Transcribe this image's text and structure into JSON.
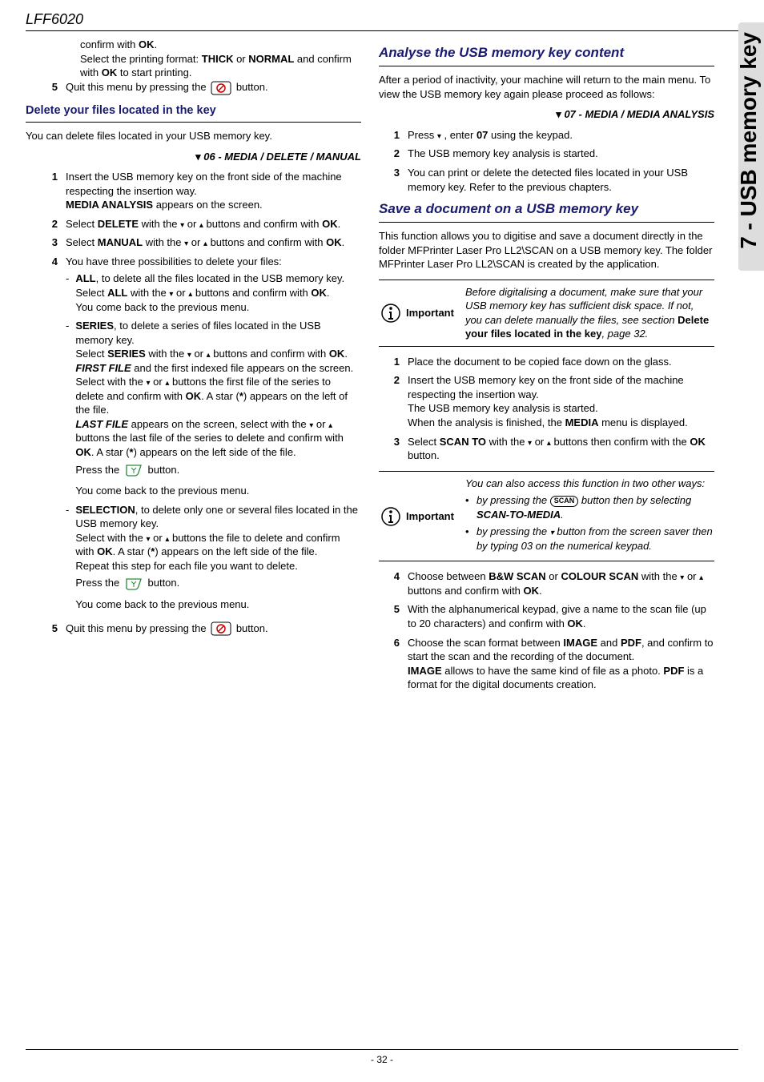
{
  "header": {
    "model": "LFF6020"
  },
  "side_tab": "7 - USB memory key",
  "footer": {
    "page_no": "- 32 -"
  },
  "left": {
    "intro": {
      "l1a": "confirm with ",
      "l1b": "OK",
      "l1c": ".",
      "l2a": "Select the printing format: ",
      "l2b": "THICK",
      "l2c": " or ",
      "l2d": "NORMAL",
      "l2e": " and confirm with ",
      "l2f": "OK",
      "l2g": " to start printing."
    },
    "step5": {
      "num": "5",
      "a": "Quit this menu by pressing the ",
      "b": " button."
    },
    "h3_delete": "Delete your files located in the key",
    "p_deleteintro": "You can delete files located in your USB memory key.",
    "menu06": "06 - MEDIA / DELETE / MANUAL",
    "d1": {
      "num": "1",
      "a": "Insert the USB memory key on the front side of the machine respecting the insertion way.",
      "b1": "MEDIA ANALYSIS",
      "b2": " appears on the screen."
    },
    "d2": {
      "num": "2",
      "a": "Select ",
      "b": "DELETE",
      "c": " with the ",
      "d": " or ",
      "e": " buttons and confirm with ",
      "f": "OK",
      "g": "."
    },
    "d3": {
      "num": "3",
      "a": "Select ",
      "b": "MANUAL",
      "c": " with the ",
      "d": " or ",
      "e": " buttons and confirm with ",
      "f": "OK",
      "g": "."
    },
    "d4": {
      "num": "4",
      "intro": "You have three possibilities to delete your files:",
      "all": {
        "a": "ALL",
        "b": ", to delete all the files located in the USB memory key.",
        "c": "Select ",
        "d": "ALL",
        "e": " with the ",
        "f": " or ",
        "g": " buttons and confirm with ",
        "h": "OK",
        "i": ".",
        "j": "You come back to the previous menu."
      },
      "series": {
        "a": "SERIES",
        "b": ", to delete a series of files located in the USB memory key.",
        "c": "Select ",
        "d": "SERIES",
        "e": " with the ",
        "f": " or ",
        "g": " buttons and confirm with ",
        "h": "OK",
        "i": ".",
        "j1": "FIRST FILE",
        "j2": " and the first indexed file appears on the screen. Select with the ",
        "j3": " or ",
        "j4": " buttons the first file of the series to delete and confirm with ",
        "j5": "OK",
        "j6": ". A star (",
        "j7": "*",
        "j8": ") appears on the left of the file.",
        "k1": "LAST FILE",
        "k2": " appears on the screen, select with the ",
        "k3": " or ",
        "k4": " buttons the last file of the series to delete and confirm with ",
        "k5": "OK",
        "k6": ". A star (",
        "k7": "*",
        "k8": ") appears on the left side of the file.",
        "l1": "Press the ",
        "l2": " button.",
        "m": "You come back to the previous menu."
      },
      "selection": {
        "a": "SELECTION",
        "b": ", to delete only one or several files located in the USB memory key.",
        "c": "Select with the ",
        "d": " or ",
        "e": " buttons the file to delete and confirm with ",
        "f": "OK",
        "g": ". A star (",
        "h": "*",
        "i": ") appears on the left side of the file.",
        "j": "Repeat this step for each file you want to delete.",
        "k1": "Press the ",
        "k2": " button.",
        "l": "You come back to the previous menu."
      }
    },
    "d5": {
      "num": "5",
      "a": "Quit this menu by pressing the ",
      "b": " button."
    }
  },
  "right": {
    "h2_analyse": "Analyse the USB memory key content",
    "p_analyse": "After a period of inactivity, your machine will return to the main menu. To view the USB memory key again please proceed as follows:",
    "menu07": "07 - MEDIA / MEDIA ANALYSIS",
    "a1": {
      "num": "1",
      "a": "Press ",
      "b": " , enter ",
      "c": "07",
      "d": " using the keypad."
    },
    "a2": {
      "num": "2",
      "a": "The USB memory key analysis is started."
    },
    "a3": {
      "num": "3",
      "a": "You can print or delete the detected files located in your USB memory key. Refer to the previous chapters."
    },
    "h2_save": "Save a document on a USB memory key",
    "p_save": "This function allows you to digitise and save a document directly in the folder MFPrinter Laser Pro LL2\\SCAN on a USB memory key. The folder MFPrinter Laser Pro LL2\\SCAN is created by the application.",
    "imp1": {
      "label": "Important",
      "a": "Before digitalising a document, make sure that your USB memory key has sufficient disk space. If not, you can delete manually the files, see section ",
      "b": "Delete your files located in the key",
      "c": ", page 32."
    },
    "s1": {
      "num": "1",
      "a": "Place the document to be copied face down on the glass."
    },
    "s2": {
      "num": "2",
      "a": "Insert the USB memory key on the front side of the machine respecting the insertion way.",
      "b": "The USB memory key analysis is started.",
      "c1": "When the analysis is finished, the ",
      "c2": "MEDIA",
      "c3": " menu is displayed."
    },
    "s3": {
      "num": "3",
      "a": "Select ",
      "b": "SCAN TO",
      "c": " with the ",
      "d": " or ",
      "e": " buttons then confirm with the ",
      "f": "OK",
      "g": " button."
    },
    "imp2": {
      "label": "Important",
      "intro": "You can also access this function in two other ways:",
      "b1a": "by pressing the ",
      "b1key": "SCAN",
      "b1b": " button then by selecting ",
      "b1c": "SCAN-TO-MEDIA",
      "b1d": ".",
      "b2a": "by pressing the ",
      "b2b": " button from the screen saver then by typing 03 on the numerical keypad."
    },
    "s4": {
      "num": "4",
      "a": "Choose between ",
      "b": "B&W SCAN",
      "c": " or ",
      "d": "COLOUR SCAN",
      "e": " with the ",
      "f": " or ",
      "g": " buttons and confirm with ",
      "h": "OK",
      "i": "."
    },
    "s5": {
      "num": "5",
      "a": "With the alphanumerical keypad, give a name to the scan file (up to 20 characters) and confirm with ",
      "b": "OK",
      "c": "."
    },
    "s6": {
      "num": "6",
      "a": "Choose the scan format between ",
      "b": "IMAGE",
      "c": " and ",
      "d": "PDF",
      "e": ", and confirm to start the scan and the recording of the document.",
      "f1": "IMAGE",
      "f2": " allows to have the same kind of file as a photo. ",
      "f3": "PDF",
      "f4": " is a format for the digital documents creation."
    }
  }
}
